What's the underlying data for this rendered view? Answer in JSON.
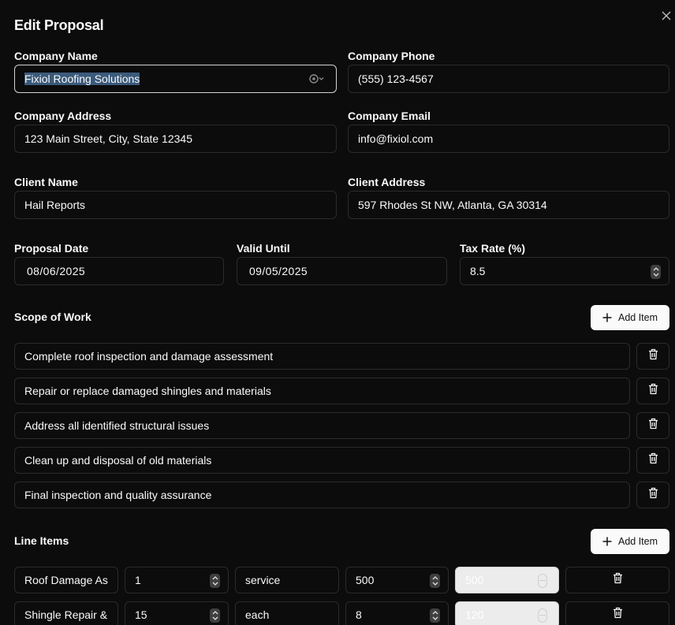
{
  "dialog": {
    "title": "Edit Proposal"
  },
  "company": {
    "name_label": "Company Name",
    "name_value": "Fixiol Roofing Solutions",
    "phone_label": "Company Phone",
    "phone_value": "(555) 123-4567",
    "address_label": "Company Address",
    "address_value": "123 Main Street, City, State 12345",
    "email_label": "Company Email",
    "email_value": "info@fixiol.com"
  },
  "client": {
    "name_label": "Client Name",
    "name_value": "Hail Reports",
    "address_label": "Client Address",
    "address_value": "597 Rhodes St NW, Atlanta, GA 30314"
  },
  "dates": {
    "proposal_label": "Proposal Date",
    "proposal_value": "08/06/2025",
    "valid_label": "Valid Until",
    "valid_value": "09/05/2025",
    "tax_label": "Tax Rate (%)",
    "tax_value": "8.5"
  },
  "scope": {
    "heading": "Scope of Work",
    "add_label": "Add Item",
    "items": [
      "Complete roof inspection and damage assessment",
      "Repair or replace damaged shingles and materials",
      "Address all identified structural issues",
      "Clean up and disposal of old materials",
      "Final inspection and quality assurance"
    ]
  },
  "line_items": {
    "heading": "Line Items",
    "add_label": "Add Item",
    "rows": [
      {
        "description": "Roof Damage As",
        "quantity": "1",
        "unit": "service",
        "price": "500",
        "total": "500"
      },
      {
        "description": "Shingle Repair &",
        "quantity": "15",
        "unit": "each",
        "price": "8",
        "total": "120"
      }
    ]
  },
  "icons": {
    "close": "close-icon",
    "plus": "plus-icon",
    "trash": "trash-icon",
    "spinner": "chevron-updown-icon",
    "credential": "key-icon"
  }
}
